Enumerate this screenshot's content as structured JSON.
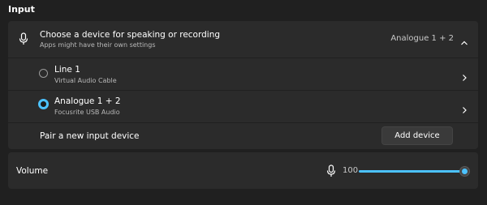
{
  "section": {
    "title": "Input"
  },
  "device_chooser": {
    "title": "Choose a device for speaking or recording",
    "subtitle": "Apps might have their own settings",
    "selected_value": "Analogue 1 + 2",
    "icon": "microphone-icon",
    "expanded": true
  },
  "devices": [
    {
      "name": "Line 1",
      "description": "Virtual Audio Cable",
      "selected": false
    },
    {
      "name": "Analogue 1 + 2",
      "description": "Focusrite USB Audio",
      "selected": true
    }
  ],
  "pair": {
    "label": "Pair a new input device",
    "button_label": "Add device"
  },
  "volume": {
    "label": "Volume",
    "value": "100",
    "level": 1.0,
    "icon": "microphone-icon"
  },
  "colors": {
    "background": "#202020",
    "card": "#2b2b2b",
    "accent": "#4cc2ff"
  }
}
